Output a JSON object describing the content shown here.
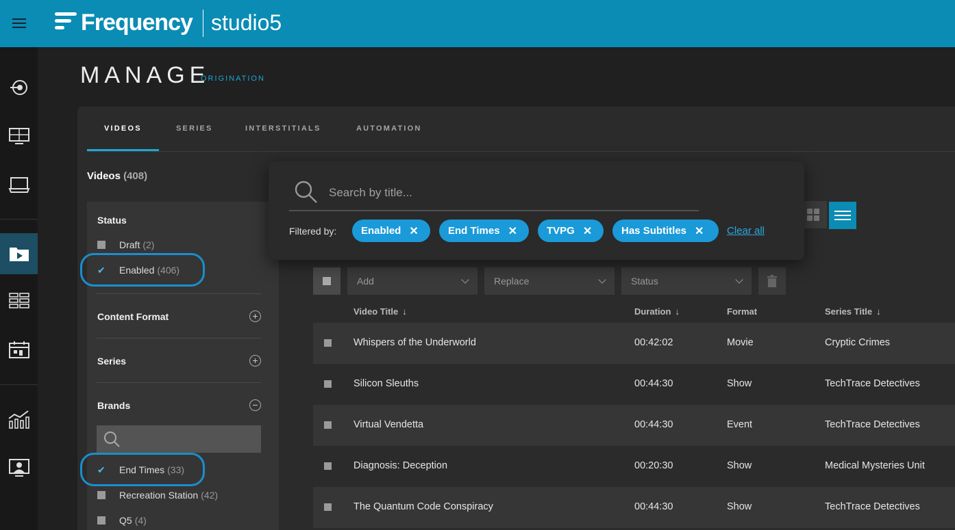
{
  "app": {
    "brand": "Frequency",
    "product": "studio5"
  },
  "page": {
    "title": "MANAGE",
    "subtitle": "ORIGINATION"
  },
  "tabs": [
    "VIDEOS",
    "SERIES",
    "INTERSTITIALS",
    "AUTOMATION"
  ],
  "videos_header": {
    "label": "Videos",
    "count": "(408)"
  },
  "filters": {
    "status": {
      "heading": "Status",
      "items": [
        {
          "label": "Draft",
          "count": "(2)",
          "checked": false
        },
        {
          "label": "Enabled",
          "count": "(406)",
          "checked": true
        }
      ]
    },
    "content_format": {
      "heading": "Content Format"
    },
    "series": {
      "heading": "Series"
    },
    "brands": {
      "heading": "Brands",
      "items": [
        {
          "label": "End Times",
          "count": "(33)",
          "checked": true
        },
        {
          "label": "Recreation Station",
          "count": "(42)",
          "checked": false
        },
        {
          "label": "Q5",
          "count": "(4)",
          "checked": false
        }
      ]
    }
  },
  "search": {
    "placeholder": "Search by title...",
    "filtered_by_label": "Filtered by:",
    "chips": [
      "Enabled",
      "End Times",
      "TVPG",
      "Has Subtitles"
    ],
    "clear_all": "Clear all"
  },
  "bulk": {
    "add": "Add",
    "replace": "Replace",
    "status": "Status"
  },
  "table": {
    "columns": [
      "Video Title",
      "Duration",
      "Format",
      "Series Title"
    ],
    "rows": [
      {
        "title": "Whispers of the Underworld",
        "duration": "00:42:02",
        "format": "Movie",
        "series": "Cryptic Crimes"
      },
      {
        "title": "Silicon Sleuths",
        "duration": "00:44:30",
        "format": "Show",
        "series": "TechTrace Detectives"
      },
      {
        "title": "Virtual Vendetta",
        "duration": "00:44:30",
        "format": "Event",
        "series": "TechTrace Detectives"
      },
      {
        "title": "Diagnosis: Deception",
        "duration": "00:20:30",
        "format": "Show",
        "series": "Medical Mysteries Unit"
      },
      {
        "title": "The Quantum Code Conspiracy",
        "duration": "00:44:30",
        "format": "Show",
        "series": "TechTrace Detectives"
      }
    ]
  },
  "colors": {
    "header": "#0a8cb4",
    "accent": "#1a9ad8",
    "background": "#202020"
  }
}
